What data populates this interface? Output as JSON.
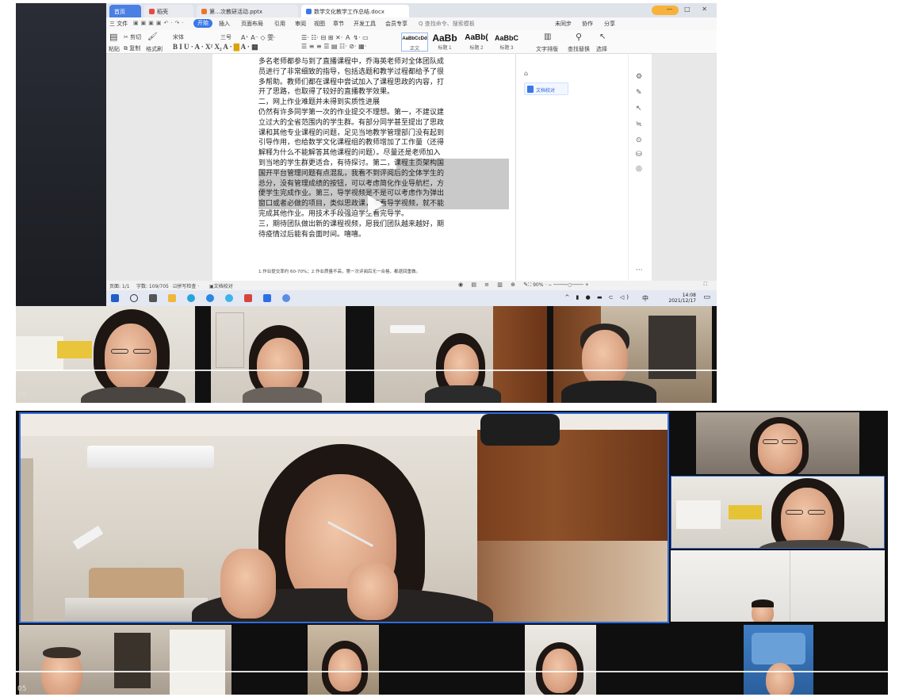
{
  "browser_tabs": [
    {
      "label": "首页"
    },
    {
      "label": "稻壳"
    },
    {
      "label": "第…次教研活动.pptx"
    },
    {
      "label": "数学文化教学工作总结.docx"
    }
  ],
  "menu": [
    "三 文件",
    "开始",
    "插入",
    "页面布局",
    "引用",
    "审阅",
    "视图",
    "章节",
    "开发工具",
    "会员专享",
    "Q 查找命令、搜索模板"
  ],
  "menu_active": "开始",
  "menu_right": [
    "未同步",
    "协作",
    "分享"
  ],
  "ribbon": {
    "paste": "粘贴",
    "cut": "剪切",
    "copy": "复制",
    "format_painter": "格式刷",
    "font": "宋体",
    "font_size": "三号",
    "styles": [
      {
        "sample": "AaBbCcDd",
        "label": "正文"
      },
      {
        "sample": "AaBb",
        "label": "标题 1"
      },
      {
        "sample": "AaBb(",
        "label": "标题 2"
      },
      {
        "sample": "AaBbC",
        "label": "标题 3"
      }
    ],
    "text_layout": "文字排版",
    "find_replace": "查找替换",
    "select": "选择"
  },
  "document": {
    "lines": [
      "多名老师都参与到了直播课程中，乔海英老师对全体团队成",
      "员进行了非常细致的指导，包括选题和教学过程都给予了很",
      "多帮助。教师们都在课程中尝试加入了课程思政的内容，打",
      "开了思路，也取得了较好的直播教学效果。",
      "二，网上作业难题并未得到实质性进展",
      "仍然有许多同学第一次的作业提交不理想。第一，不建议建",
      "立过大的全省范围内的学生群。有部分同学甚至提出了思政",
      "课和其他专业课程的问题，足见当地教学管理部门没有起到",
      "引导作用，也给数学文化课程组的教师增加了工作量（还得",
      "解释为什么不能解答其他课程的问题）。尽量还是老师加入",
      "到当地的学生群更适合，有待探讨。第二，课程主页架构国",
      "国开平台管理问题有点混乱，我看不到评阅后的全体学生的",
      "总分，没有管理成绩的按钮，可以考虑简化作业导航栏，方",
      "便学生完成作业。第三，导学视频是不是可以考虑作为弹出",
      "窗口或者必做的项目，类似思政课，不看导学视频，就不能",
      "完成其他作业。用技术手段强迫学生看完导学。",
      "三，期待团队做出新的课程视频，愿我们团队越来越好，期",
      "待疫情过后能有会面时间。嘻嘻。"
    ],
    "footnote": "1.作业提交率约 60-70%；2.作业质量不高，第一次评阅后无一合格，都退回重做。"
  },
  "side_panel": {
    "doc_review": "文档校对"
  },
  "statusbar": {
    "page": "页面: 1/1",
    "words": "字数: 109/705",
    "spell": "拼写检查",
    "doc_review": "文档校对",
    "zoom": "90%"
  },
  "taskbar": {
    "time": "14:08",
    "date": "2021/12/17",
    "ime": "中"
  },
  "tile_numbers": {
    "panel1": "05",
    "panel2": "05"
  }
}
